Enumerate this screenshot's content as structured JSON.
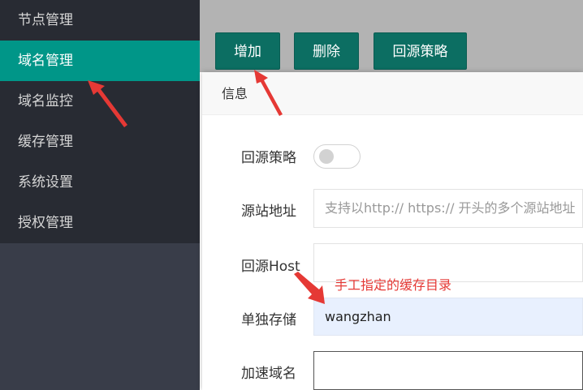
{
  "sidebar": {
    "items": [
      {
        "label": "节点管理"
      },
      {
        "label": "域名管理",
        "active": true
      },
      {
        "label": "域名监控"
      },
      {
        "label": "缓存管理"
      },
      {
        "label": "系统设置"
      },
      {
        "label": "授权管理"
      }
    ]
  },
  "toolbar": {
    "add_label": "增加",
    "delete_label": "删除",
    "origin_policy_label": "回源策略"
  },
  "dialog": {
    "title": "信息",
    "fields": {
      "origin_policy": {
        "label": "回源策略",
        "enabled": false
      },
      "origin_address": {
        "label": "源站地址",
        "placeholder": "支持以http:// https:// 开头的多个源站地址"
      },
      "origin_host": {
        "label": "回源Host",
        "value": ""
      },
      "separate_storage": {
        "label": "单独存储",
        "value": "wangzhan"
      },
      "accel_domain": {
        "label": "加速域名",
        "value": ""
      }
    }
  },
  "annotation": {
    "text": "手工指定的缓存目录",
    "color": "#e53935"
  },
  "colors": {
    "sidebar_bg": "#282b33",
    "active_bg": "#009688",
    "button_bg": "#0c6e62",
    "field_highlight": "#e8f0fe"
  }
}
